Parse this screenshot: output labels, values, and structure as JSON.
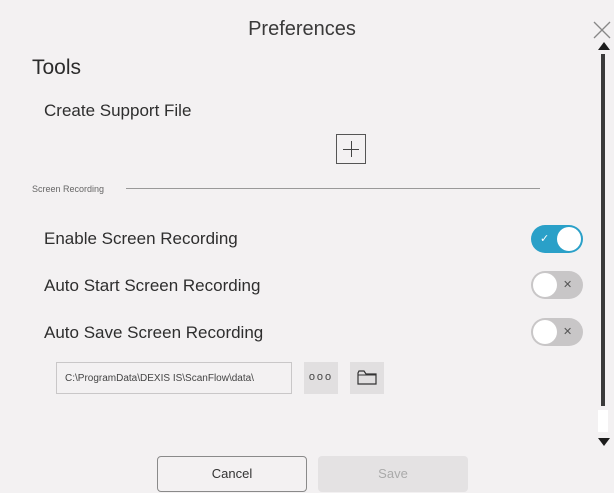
{
  "dialog": {
    "title": "Preferences",
    "close_icon": "close-icon"
  },
  "tools": {
    "heading": "Tools",
    "create_support_file_label": "Create Support File",
    "add_icon": "plus-icon"
  },
  "screen_recording": {
    "section_label": "Screen Recording",
    "enable": {
      "label": "Enable Screen Recording",
      "on": true,
      "glyph": "✓"
    },
    "auto_start": {
      "label": "Auto Start Screen Recording",
      "on": false,
      "glyph": "✕"
    },
    "auto_save": {
      "label": "Auto Save Screen Recording",
      "on": false,
      "glyph": "✕"
    },
    "path_value": "C:\\ProgramData\\DEXIS IS\\ScanFlow\\data\\",
    "browse_label": "ooo",
    "folder_icon": "folder-icon"
  },
  "footer": {
    "cancel_label": "Cancel",
    "save_label": "Save"
  },
  "colors": {
    "toggle_on": "#2aa0c8",
    "toggle_off": "#c8c6c7",
    "background": "#f3f1f2"
  }
}
